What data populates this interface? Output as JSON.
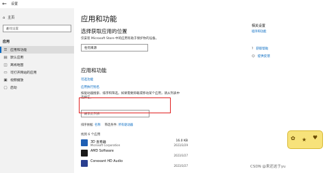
{
  "titlebar": {
    "back_icon": "←",
    "title": "设置"
  },
  "sidebar": {
    "home_label": "主页",
    "search_placeholder": "查找设置",
    "section_label": "应用",
    "items": [
      {
        "label": "应用和功能",
        "icon": "apps-icon",
        "glyph": "☰",
        "active": true
      },
      {
        "label": "默认应用",
        "icon": "default-apps-icon",
        "glyph": "▤",
        "active": false
      },
      {
        "label": "离线地图",
        "icon": "map-icon",
        "glyph": "◫",
        "active": false
      },
      {
        "label": "可打开网站的应用",
        "icon": "web-apps-icon",
        "glyph": "▭",
        "active": false
      },
      {
        "label": "视频播放",
        "icon": "video-icon",
        "glyph": "▣",
        "active": false
      },
      {
        "label": "启动",
        "icon": "startup-icon",
        "glyph": "▢",
        "active": false
      }
    ]
  },
  "main": {
    "title": "应用和功能",
    "section1_title": "选择获取应用的位置",
    "section1_text": "仅安装 Microsoft Store 中的应用有助于保护你的设备。",
    "dropdown_value": "任何来源",
    "section2_title": "应用和功能",
    "optional_features_link": "可选功能",
    "app_alias_link": "应用执行别名",
    "search_desc_line1": "按驱动器搜索、排序和筛选。如果需要卸载或移动某个应用，请从列表中",
    "search_desc_line2": "选择它。",
    "app_search_placeholder": "搜索此列表",
    "sort_label": "排序依据:",
    "sort_value": "名称",
    "filter_label": "筛选条件:",
    "filter_value": "所有驱动器",
    "count_text": "找到 6 个应用",
    "apps": [
      {
        "name": "3D 查看器",
        "publisher": "Microsoft Corporation",
        "size": "16.0 KB",
        "date": "2023/3/29",
        "icon": "3d-viewer-icon",
        "color": "#1e5fb4"
      },
      {
        "name": "AMD Software",
        "publisher": "",
        "size": "",
        "date": "2023/3/27",
        "icon": "amd-icon",
        "color": "#1a1a1a"
      },
      {
        "name": "Conexant HD Audio",
        "publisher": "",
        "size": "",
        "date": "2023/3/27",
        "icon": "audio-icon",
        "color": "#2a3f8f"
      }
    ]
  },
  "right_panel": {
    "related_title": "相关设置",
    "related_link": "程序和功能",
    "help_label": "获取帮助",
    "feedback_label": "提供反馈"
  },
  "overlays": {
    "watermark": "CSDN @来还这于yu"
  },
  "colors": {
    "accent": "#0067c0",
    "highlight": "#e02020"
  }
}
